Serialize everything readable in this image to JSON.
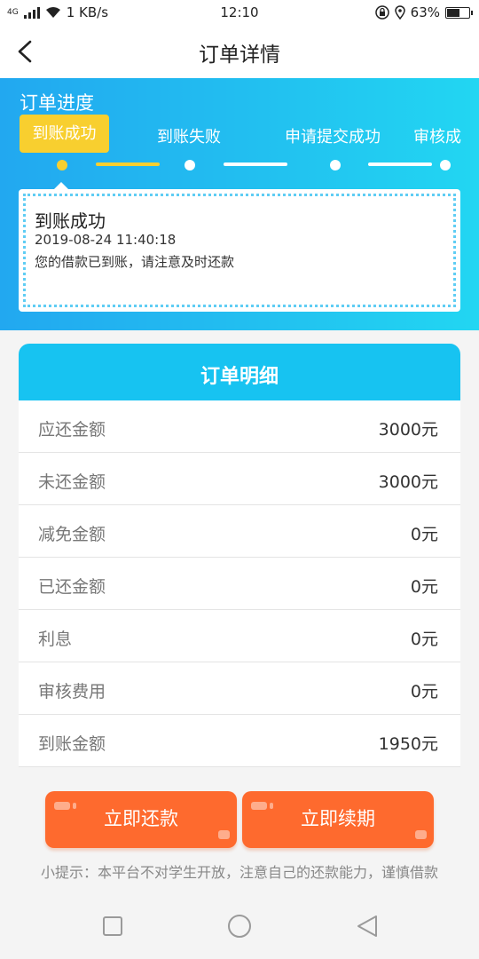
{
  "status_bar": {
    "network_type": "4G",
    "speed": "1 KB/s",
    "time": "12:10",
    "battery": "63%",
    "battery_level": 0.63
  },
  "header": {
    "title": "订单详情",
    "back_icon": "chevron-left-icon"
  },
  "progress": {
    "title": "订单进度",
    "steps": [
      {
        "label": "到账成功",
        "active": true
      },
      {
        "label": "到账失败",
        "active": false
      },
      {
        "label": "申请提交成功",
        "active": false
      },
      {
        "label": "审核成",
        "active": false
      }
    ],
    "detail": {
      "status": "到账成功",
      "time": "2019-08-24 11:40:18",
      "message": "您的借款已到账，请注意及时还款"
    }
  },
  "order_detail": {
    "title": "订单明细",
    "rows": [
      {
        "label": "应还金额",
        "value": "3000元"
      },
      {
        "label": "未还金额",
        "value": "3000元"
      },
      {
        "label": "减免金额",
        "value": "0元"
      },
      {
        "label": "已还金额",
        "value": "0元"
      },
      {
        "label": "利息",
        "value": "0元"
      },
      {
        "label": "审核费用",
        "value": "0元"
      },
      {
        "label": "到账金额",
        "value": "1950元"
      }
    ]
  },
  "actions": {
    "repay_label": "立即还款",
    "renew_label": "立即续期"
  },
  "tip": "小提示：本平台不对学生开放，注意自己的还款能力，谨慎借款",
  "colors": {
    "accent_blue": "#17c3f1",
    "active_step": "#f8cf2f",
    "action_orange": "#fe6a2e"
  }
}
